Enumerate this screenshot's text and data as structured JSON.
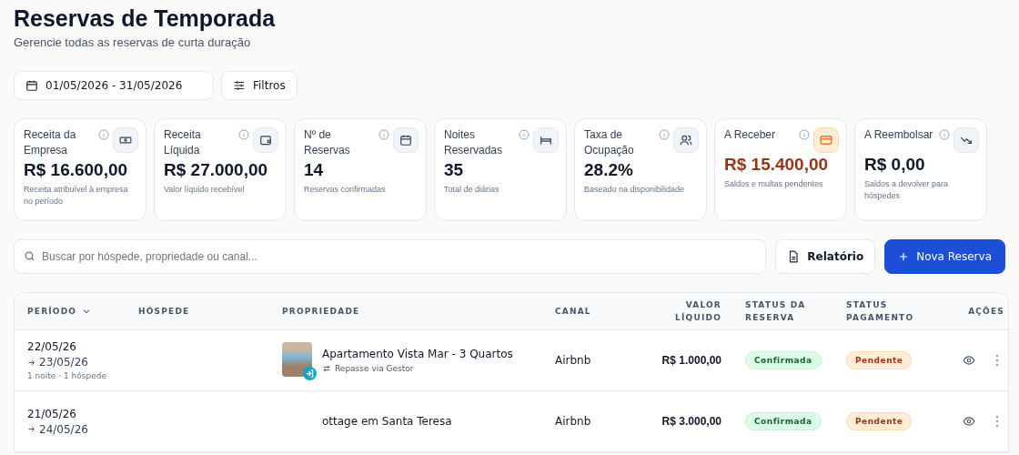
{
  "header": {
    "title": "Reservas de Temporada",
    "subtitle": "Gerencie todas as reservas de curta duração"
  },
  "toolbar": {
    "date_range": "01/05/2026 - 31/05/2026",
    "filters": "Filtros"
  },
  "cards": [
    {
      "label": "Receita da Empresa",
      "value": "R$ 16.600,00",
      "note": "Receita atribuível à empresa no período",
      "kind": "cash",
      "accent": false
    },
    {
      "label": "Receita Líquida",
      "value": "R$ 27.000,00",
      "note": "Valor líquido recebível",
      "kind": "wallet",
      "accent": false
    },
    {
      "label": "Nº de Reservas",
      "value": "14",
      "note": "Reservas confirmadas",
      "kind": "calendar",
      "accent": false
    },
    {
      "label": "Noites Reservadas",
      "value": "35",
      "note": "Total de diárias",
      "kind": "bed",
      "accent": false
    },
    {
      "label": "Taxa de Ocupação",
      "value": "28.2%",
      "note": "Baseado na disponibilidade",
      "kind": "users",
      "accent": false
    },
    {
      "label": "A Receber",
      "value": "R$ 15.400,00",
      "note": "Saldos e multas pendentes",
      "kind": "card",
      "accent": true
    },
    {
      "label": "A Reembolsar",
      "value": "R$ 0,00",
      "note": "Saldos a devolver para hóspedes",
      "kind": "trend",
      "accent": false
    }
  ],
  "search": {
    "placeholder": "Buscar por hóspede, propriedade ou canal..."
  },
  "buttons": {
    "report": "Relatório",
    "new": "Nova Reserva"
  },
  "table": {
    "columns": [
      {
        "label": "PERÍODO",
        "sorted": true
      },
      {
        "label": "HÓSPEDE",
        "sorted": false
      },
      {
        "label": "PROPRIEDADE",
        "sorted": false
      },
      {
        "label": "CANAL",
        "sorted": false
      },
      {
        "label": "VALOR LÍQUIDO",
        "sorted": false
      },
      {
        "label": "STATUS DA RESERVA",
        "sorted": false
      },
      {
        "label": "STATUS PAGAMENTO",
        "sorted": false
      },
      {
        "label": "AÇÕES",
        "sorted": false
      }
    ],
    "rows": [
      {
        "start": "22/05/26",
        "end": "23/05/26",
        "details": "1 noite · 1 hóspede",
        "property": "Apartamento Vista Mar - 3 Quartos",
        "payout": "Repasse via Gestor",
        "photo": true,
        "channel": "Airbnb",
        "value": "R$ 1.000,00",
        "status": "Confirmada",
        "payment": "Pendente"
      },
      {
        "start": "21/05/26",
        "end": "24/05/26",
        "property": "ottage em Santa Teresa",
        "photo": false,
        "channel": "Airbnb",
        "value": "R$ 3.000,00",
        "status": "Confirmada",
        "payment": "Pendente"
      }
    ]
  }
}
